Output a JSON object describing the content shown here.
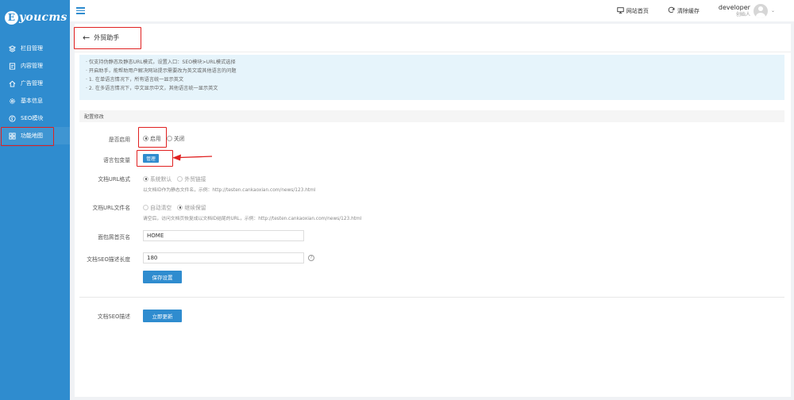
{
  "brand": {
    "logo_letter": "E",
    "logo_text": "youcms"
  },
  "sidebar": {
    "items": [
      {
        "label": "栏目管理",
        "icon": "layers-icon"
      },
      {
        "label": "内容管理",
        "icon": "document-icon"
      },
      {
        "label": "广告管理",
        "icon": "home-icon"
      },
      {
        "label": "基本信息",
        "icon": "gear-icon"
      },
      {
        "label": "SEO模块",
        "icon": "seo-icon"
      },
      {
        "label": "功能地图",
        "icon": "grid-icon"
      }
    ]
  },
  "topbar": {
    "site_home": "网站首页",
    "clear_cache": "清除缓存",
    "user_name": "developer",
    "user_role": "创始人"
  },
  "page": {
    "title": "外贸助手"
  },
  "tips": [
    "· 仅支持伪静态及静态URL模式，设置入口：SEO模块>URL模式选择",
    "· 开启助手，能帮助用户解决网站提示需要改为英文或其他语言的问题",
    "·      1. 在单语言情况下，所有语言统一显示英文",
    "·      2. 在多语言情况下，中文显示中文，其他语言统一显示英文"
  ],
  "section": {
    "title": "配置修改"
  },
  "form": {
    "enable": {
      "label": "是否启用",
      "on": "启用",
      "off": "关闭"
    },
    "lang_var": {
      "label": "语言包变量",
      "button": "管理"
    },
    "doc_url": {
      "label": "文档URL格式",
      "opt1": "系统默认",
      "opt2": "外贸链接",
      "hint": "以文档ID作为静态文件名，示例：http://testen.cankaoxian.com/news/123.html"
    },
    "doc_url_filename": {
      "label": "文档URL文件名",
      "opt1": "自动清空",
      "opt2": "继续保留",
      "hint": "请空后，访问文档页恢复成以文档ID结尾的URL，示例：http://testen.cankaoxian.com/news/123.html"
    },
    "breadcrumb": {
      "label": "面包屑首页名",
      "value": "HOME"
    },
    "seo_desc_len": {
      "label": "文档SEO描述长度",
      "value": "180",
      "help": "?"
    },
    "save_button": "保存设置",
    "doc_seo": {
      "label": "文档SEO描述",
      "button": "立即更新"
    }
  },
  "colors": {
    "accent": "#2f8ccf",
    "highlight": "#e02020",
    "tips_bg": "#e6f4fb"
  }
}
